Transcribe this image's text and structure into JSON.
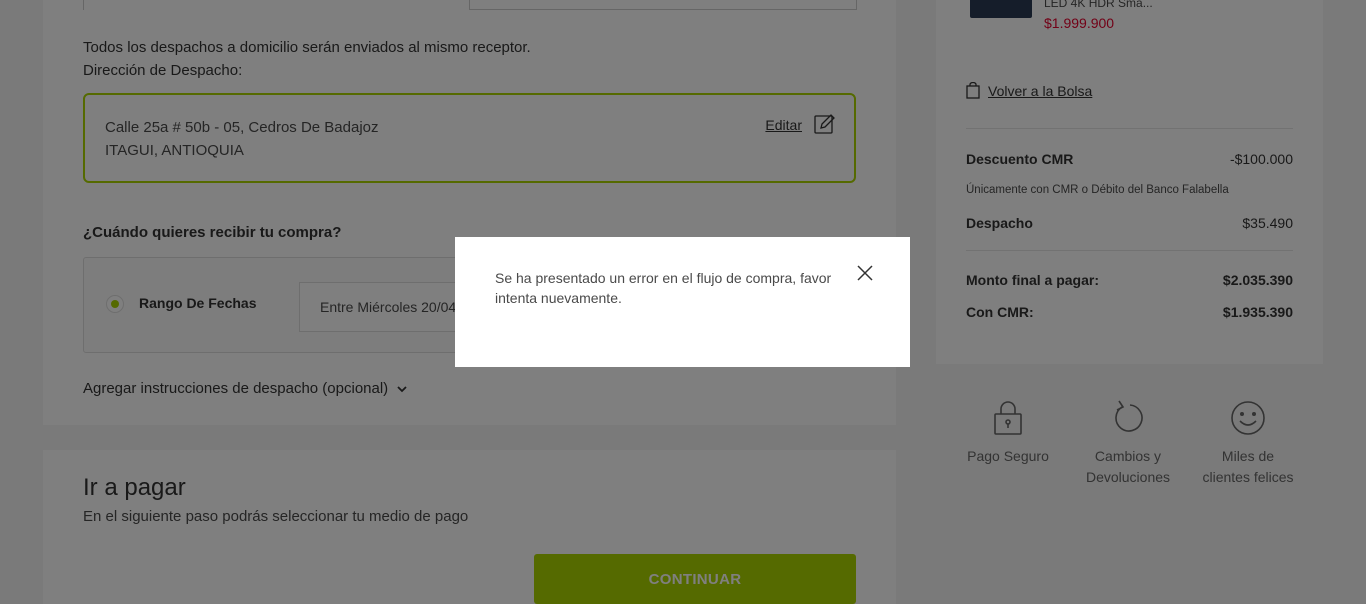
{
  "delivery": {
    "same_receiver_note": "Todos los despachos a domicilio serán enviados al mismo receptor.",
    "address_label": "Dirección de Despacho:",
    "address_line1": "Calle 25a # 50b - 05, Cedros De Badajoz",
    "address_line2": "ITAGUI, ANTIOQUIA",
    "edit_label": "Editar",
    "when_title": "¿Cuándo quieres recibir tu compra?",
    "range_label": "Rango De Fechas",
    "date_value": "Entre Miércoles 20/04",
    "instructions_label": "Agregar instrucciones de despacho (opcional)"
  },
  "payment": {
    "title": "Ir a pagar",
    "subtitle": "En el siguiente paso podrás seleccionar tu medio de pago",
    "continue_label": "CONTINUAR"
  },
  "summary": {
    "product_name": "LED 4K HDR Sma...",
    "product_price": "$1.999.900",
    "back_to_bag": "Volver a la Bolsa",
    "cmr_discount_label": "Descuento CMR",
    "cmr_discount_value": "-$100.000",
    "cmr_note": "Únicamente con CMR o Débito del Banco Falabella",
    "shipping_label": "Despacho",
    "shipping_value": "$35.490",
    "final_label": "Monto final a pagar:",
    "final_value": "$2.035.390",
    "with_cmr_label": "Con CMR:",
    "with_cmr_value": "$1.935.390"
  },
  "features": {
    "secure": "Pago Seguro",
    "returns_line1": "Cambios y",
    "returns_line2": "Devoluciones",
    "happy_line1": "Miles de",
    "happy_line2": "clientes felices"
  },
  "modal": {
    "message": "Se ha presentado un error en el flujo de compra, favor intenta nuevamente."
  },
  "colors": {
    "accent": "#aad500",
    "price": "#e4032e"
  },
  "icons": [
    "edit-icon",
    "radio-selected-icon",
    "chevron-down-icon",
    "bag-icon",
    "lock-icon",
    "returns-icon",
    "smile-icon",
    "close-icon"
  ]
}
